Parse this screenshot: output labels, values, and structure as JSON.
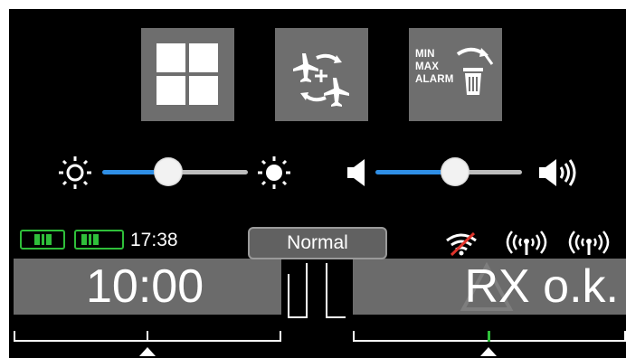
{
  "quick_actions": {
    "layout_tile": {
      "icon": "four-squares-grid-icon"
    },
    "model_tile": {
      "icon": "add-model-cycle-icon"
    },
    "reset_tile": {
      "icon": "reset-min-max-alarm-icon",
      "lines": [
        "MIN",
        "MAX",
        "ALARM"
      ]
    }
  },
  "brightness": {
    "icon_low": "sun-outline-icon",
    "icon_high": "sun-filled-icon",
    "level": 0.45
  },
  "volume": {
    "icon_low": "speaker-icon",
    "icon_high": "speaker-loud-icon",
    "level": 0.55
  },
  "status": {
    "time": "17:38",
    "mode": "Normal",
    "battery_color": "#2fbf3a",
    "signal_icons": [
      "wifi-disabled-icon",
      "antenna-signal-icon",
      "antenna-signal-icon"
    ],
    "disabled_color": "#e0342b"
  },
  "left_box": {
    "value": "10:00"
  },
  "right_box": {
    "value": "RX o.k."
  },
  "colors": {
    "accent": "#2f8fe6",
    "tile": "#6e6e6e",
    "box": "#6b6b6b"
  }
}
